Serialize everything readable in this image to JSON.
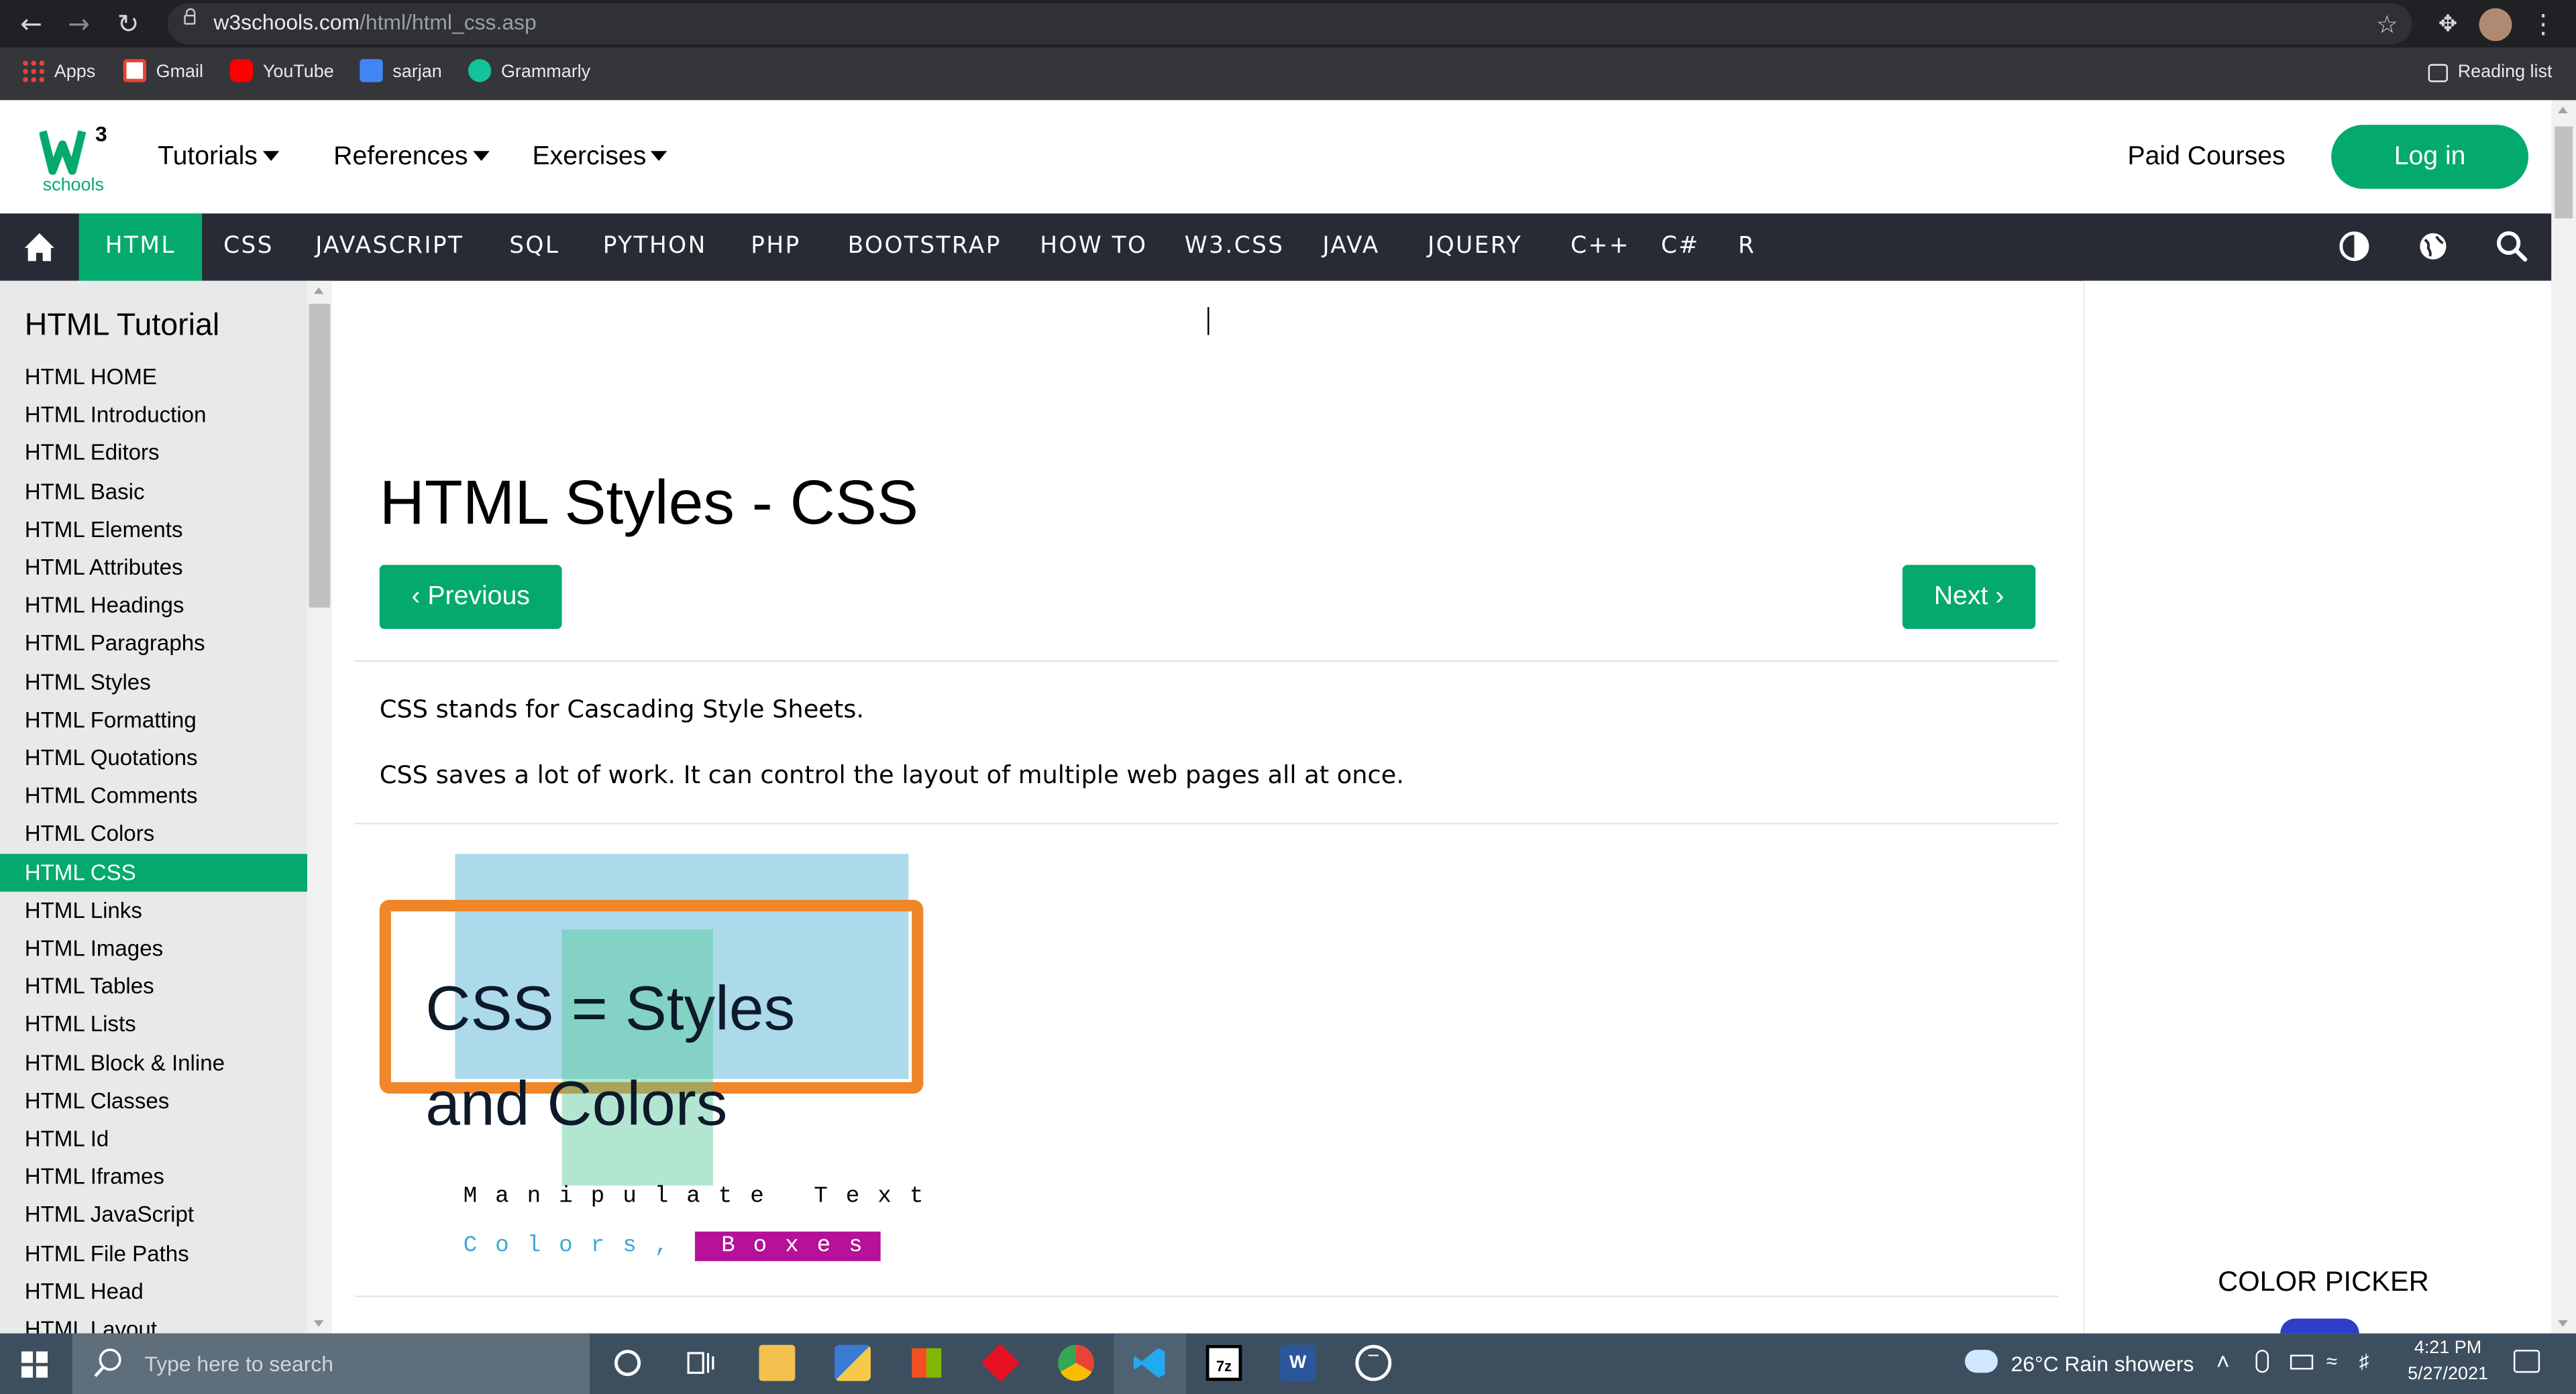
{
  "browser": {
    "url_host": "w3schools.com",
    "url_path": "/html/html_css.asp",
    "bookmarks": [
      "Apps",
      "Gmail",
      "YouTube",
      "sarjan",
      "Grammarly"
    ],
    "reading_list": "Reading list"
  },
  "header": {
    "logo_text": "schools",
    "logo_sup": "3",
    "nav": [
      "Tutorials",
      "References",
      "Exercises"
    ],
    "paid_courses": "Paid Courses",
    "login": "Log in"
  },
  "topnav": {
    "items": [
      "HTML",
      "CSS",
      "JAVASCRIPT",
      "SQL",
      "PYTHON",
      "PHP",
      "BOOTSTRAP",
      "HOW TO",
      "W3.CSS",
      "JAVA",
      "JQUERY",
      "C++",
      "C#",
      "R"
    ],
    "active": "HTML"
  },
  "sidebar": {
    "title": "HTML Tutorial",
    "items": [
      "HTML HOME",
      "HTML Introduction",
      "HTML Editors",
      "HTML Basic",
      "HTML Elements",
      "HTML Attributes",
      "HTML Headings",
      "HTML Paragraphs",
      "HTML Styles",
      "HTML Formatting",
      "HTML Quotations",
      "HTML Comments",
      "HTML Colors",
      "HTML CSS",
      "HTML Links",
      "HTML Images",
      "HTML Tables",
      "HTML Lists",
      "HTML Block & Inline",
      "HTML Classes",
      "HTML Id",
      "HTML Iframes",
      "HTML JavaScript",
      "HTML File Paths",
      "HTML Head",
      "HTML Layout"
    ],
    "active": "HTML CSS"
  },
  "main": {
    "title": "HTML Styles - CSS",
    "prev": "Previous",
    "next": "Next",
    "p1": "CSS stands for Cascading Style Sheets.",
    "p2": "CSS saves a lot of work. It can control the layout of multiple web pages all at once.",
    "illustration": {
      "line1": "CSS = Styles",
      "line2": "and Colors",
      "line3": "Manipulate Text",
      "line4a": "Colors,",
      "line4b": "Boxes"
    }
  },
  "right": {
    "color_picker": "COLOR PICKER"
  },
  "taskbar": {
    "search_placeholder": "Type here to search",
    "weather": "26°C  Rain showers",
    "time": "4:21 PM",
    "date": "5/27/2021"
  },
  "colors": {
    "accent": "#04aa6d",
    "topnav_bg": "#282a35",
    "sidebar_bg": "#e7e9eb"
  }
}
